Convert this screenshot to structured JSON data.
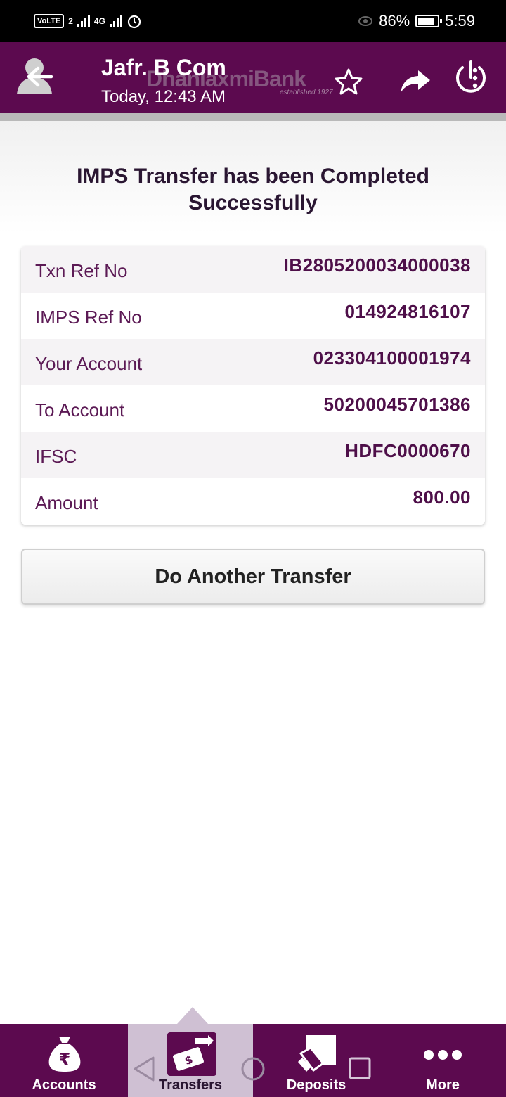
{
  "status_bar": {
    "carrier_badge": "VoLTE",
    "sim_number": "2",
    "network": "4G",
    "battery": "86%",
    "time": "5:59"
  },
  "header": {
    "chat_title": "Jafr. B Com",
    "chat_subtitle": "Today, 12:43 AM",
    "bank_logo_text": "DhanlaxmiBank",
    "bank_logo_sub": "established 1927"
  },
  "main": {
    "heading": "IMPS Transfer has been Completed Successfully",
    "details": [
      {
        "label": "Txn Ref No",
        "value": "IB2805200034000038"
      },
      {
        "label": "IMPS Ref No",
        "value": "014924816107"
      },
      {
        "label": "Your Account",
        "value": "023304100001974"
      },
      {
        "label": "To Account",
        "value": "50200045701386"
      },
      {
        "label": "IFSC",
        "value": "HDFC0000670"
      },
      {
        "label": "Amount",
        "value": "800.00"
      }
    ],
    "action_button": "Do Another Transfer"
  },
  "bottom_nav": {
    "items": [
      {
        "label": "Accounts",
        "icon": "money-bag-icon"
      },
      {
        "label": "Transfers",
        "icon": "transfer-icon",
        "active": true
      },
      {
        "label": "Deposits",
        "icon": "deposit-icon"
      },
      {
        "label": "More",
        "icon": "more-dots-icon"
      }
    ]
  },
  "colors": {
    "brand": "#5c0a4f",
    "active_tab": "#cfc0d3",
    "text_value": "#4e0f49"
  }
}
